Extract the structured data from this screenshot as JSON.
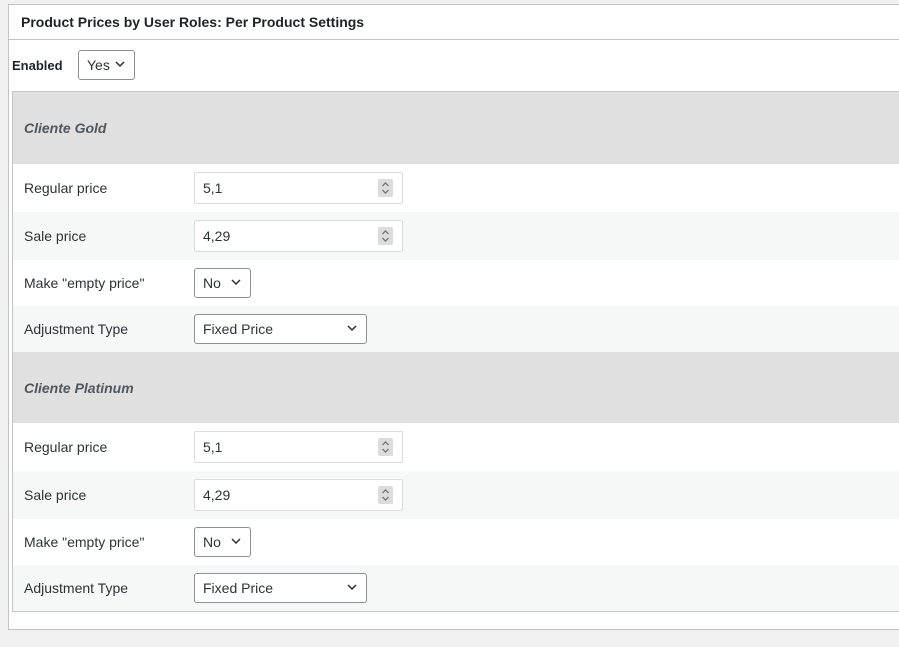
{
  "metabox": {
    "title": "Product Prices by User Roles: Per Product Settings"
  },
  "enabled": {
    "label": "Enabled",
    "value": "Yes"
  },
  "roles": [
    {
      "name": "Cliente Gold",
      "regular_price_label": "Regular price",
      "regular_price": "5,1",
      "sale_price_label": "Sale price",
      "sale_price": "4,29",
      "empty_price_label": "Make \"empty price\"",
      "empty_price": "No",
      "adjustment_label": "Adjustment Type",
      "adjustment": "Fixed Price"
    },
    {
      "name": "Cliente Platinum",
      "regular_price_label": "Regular price",
      "regular_price": "5,1",
      "sale_price_label": "Sale price",
      "sale_price": "4,29",
      "empty_price_label": "Make \"empty price\"",
      "empty_price": "No",
      "adjustment_label": "Adjustment Type",
      "adjustment": "Fixed Price"
    }
  ],
  "icons": {
    "chevron": "chevron-down-icon",
    "spinner": "number-spinner-icon"
  },
  "colors": {
    "role_header_bg": "#e0e0e0",
    "alt_row_bg": "#f6f7f7",
    "border": "#c3c4c7"
  }
}
